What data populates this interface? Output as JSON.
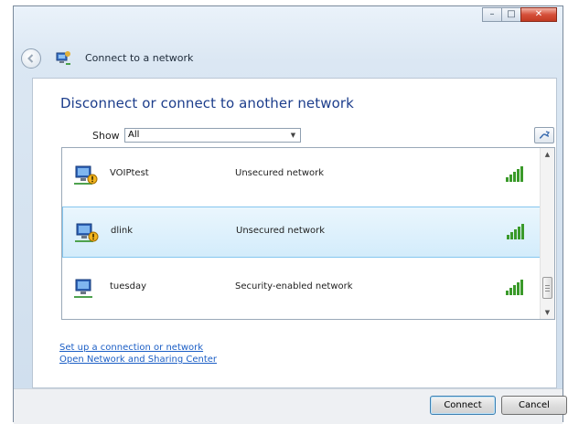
{
  "window": {
    "title": "Connect to a network",
    "caption_buttons": {
      "minimize_glyph": "–",
      "maximize_glyph": "□",
      "close_glyph": "✕"
    }
  },
  "heading": "Disconnect or connect to another network",
  "filter": {
    "label": "Show",
    "selected": "All"
  },
  "networks": [
    {
      "name": "VOIPtest",
      "security": "Unsecured network",
      "signal_bars": 5,
      "warning": true
    },
    {
      "name": "dlink",
      "security": "Unsecured network",
      "signal_bars": 5,
      "warning": true,
      "selected": true
    },
    {
      "name": "tuesday",
      "security": "Security-enabled network",
      "signal_bars": 5,
      "warning": false
    }
  ],
  "links": {
    "setup": "Set up a connection or network",
    "sharing_center": "Open Network and Sharing Center"
  },
  "buttons": {
    "connect": "Connect",
    "cancel": "Cancel"
  },
  "colors": {
    "heading": "#1d3e8c",
    "link": "#1b5ec5",
    "selection": "#d3ecfb",
    "signal": "#3a9a2a"
  }
}
